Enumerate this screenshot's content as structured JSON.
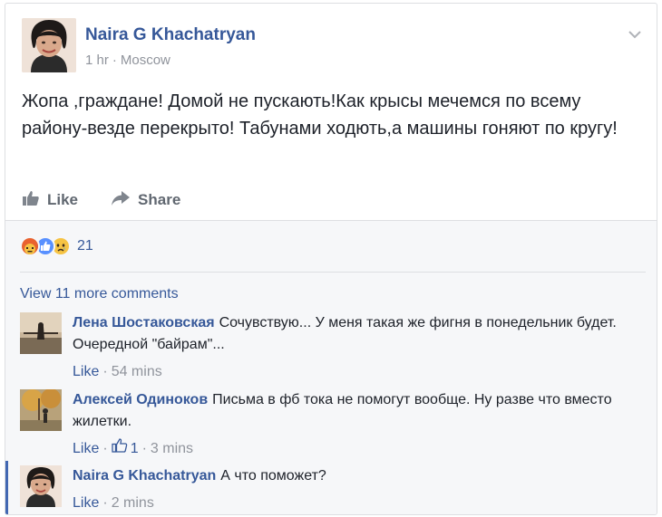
{
  "post": {
    "author": "Naira G Khachatryan",
    "time": "1 hr",
    "separator": "·",
    "location": "Moscow",
    "text": "Жопа ,граждане! Домой не пускають!Как крысы мечемся по всему району-везде перекрыто! Табунами ходють,а машины гоняют по кругу!",
    "actions": {
      "like": "Like",
      "share": "Share"
    }
  },
  "reactions": {
    "icons": [
      "angry-reaction-icon",
      "like-reaction-icon",
      "sad-reaction-icon"
    ],
    "count": "21"
  },
  "view_more": "View 11 more comments",
  "comments": [
    {
      "author": "Лена Шостаковская",
      "text": "Сочувствую... У меня такая же фигня в понедельник будет. Очередной \"байрам\"...",
      "like": "Like",
      "sep": "·",
      "time": "54 mins"
    },
    {
      "author": "Алексей Одиноков",
      "text": "Письма в фб тока не помогут вообще. Ну разве что вместо жилетки.",
      "like": "Like",
      "sep": "·",
      "likes": "1",
      "time": "3 mins"
    },
    {
      "author": "Naira G Khachatryan",
      "text": "А что поможет?",
      "like": "Like",
      "sep": "·",
      "time": "2 mins"
    }
  ],
  "colors": {
    "link": "#365899",
    "muted": "#90949c",
    "text": "#1d2129",
    "comment_bg": "#f6f7f9",
    "active_bar": "#4267b2"
  }
}
